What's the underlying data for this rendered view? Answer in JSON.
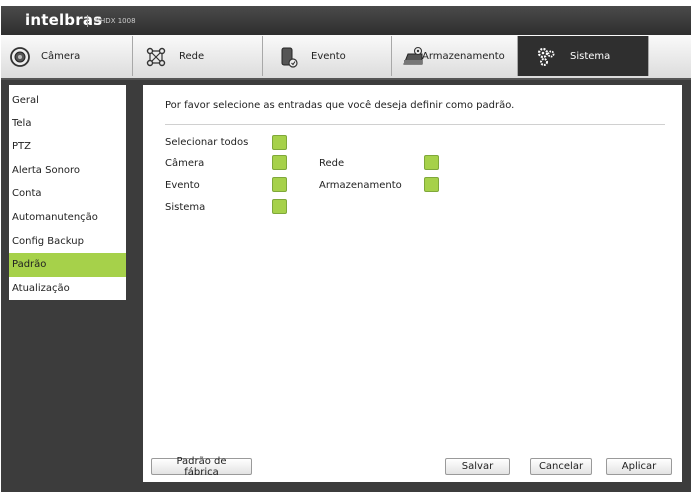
{
  "header": {
    "brand": "intelbras",
    "model": "MHDX 1008"
  },
  "tabs": [
    {
      "label": "Câmera",
      "icon": "camera-icon"
    },
    {
      "label": "Rede",
      "icon": "network-icon"
    },
    {
      "label": "Evento",
      "icon": "event-icon"
    },
    {
      "label": "Armazenamento",
      "icon": "storage-icon"
    },
    {
      "label": "Sistema",
      "icon": "gears-icon",
      "active": true
    }
  ],
  "sidebar": {
    "items": [
      "Geral",
      "Tela",
      "PTZ",
      "Alerta Sonoro",
      "Conta",
      "Automanutenção",
      "Config Backup",
      "Padrão",
      "Atualização"
    ],
    "active": "Padrão"
  },
  "main": {
    "prompt": "Por favor selecione as entradas que você deseja definir como padrão.",
    "select_all": "Selecionar todos",
    "options": {
      "camera": "Câmera",
      "rede": "Rede",
      "evento": "Evento",
      "armazenamento": "Armazenamento",
      "sistema": "Sistema"
    }
  },
  "buttons": {
    "factory_default": "Padrão de fábrica",
    "save": "Salvar",
    "cancel": "Cancelar",
    "apply": "Aplicar"
  },
  "colors": {
    "accent": "#a6d14a",
    "dark": "#3c3c3c",
    "tab_active": "#2f2f2f"
  }
}
